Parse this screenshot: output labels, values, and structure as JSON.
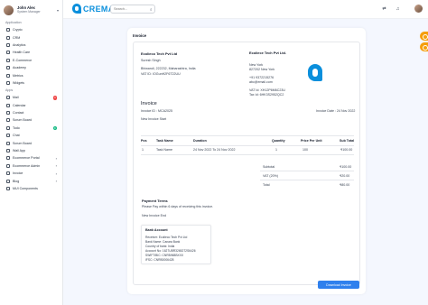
{
  "user": {
    "name": "John Alex",
    "role": "System Manager"
  },
  "sections": {
    "application": "Application",
    "apps": "Apps"
  },
  "app_items": [
    {
      "label": "Crypto"
    },
    {
      "label": "CRM"
    },
    {
      "label": "Analytics"
    },
    {
      "label": "Health Care"
    },
    {
      "label": "E-Commerce"
    },
    {
      "label": "Academy"
    },
    {
      "label": "Metrics"
    },
    {
      "label": "Widgets"
    }
  ],
  "apps_items": [
    {
      "label": "Mail",
      "badge": "4",
      "badge_color": "#ef4444"
    },
    {
      "label": "Calendar"
    },
    {
      "label": "Contact"
    },
    {
      "label": "Scrum Board"
    },
    {
      "label": "Todo",
      "badge": "9",
      "badge_color": "#10b981"
    },
    {
      "label": "Chat"
    },
    {
      "label": "Scrum Board"
    },
    {
      "label": "Wall App"
    },
    {
      "label": "Ecommerce Portal",
      "chevron": "›"
    },
    {
      "label": "Ecommerce Admin",
      "chevron": "›"
    },
    {
      "label": "Invoice",
      "chevron": "›"
    },
    {
      "label": "Blog",
      "chevron": "›"
    },
    {
      "label": "MUI Components"
    }
  ],
  "topbar": {
    "logo": "CREMA",
    "search_placeholder": "Search..."
  },
  "invoice": {
    "card_title": "Invoice",
    "from_company": "Ecolieco Tech Pvt Ltd",
    "from_person": "Suresh Singh",
    "from_address": "Bhiwandi, 222232, Maharashtra, India",
    "from_vat": "VAT ID: IOGunH2F6T22UU",
    "to_company": "Ecoliece Tech Pvt Ltd.",
    "to_city": "New York",
    "to_zip": "827202 New York",
    "to_phone": "+91 9372215276",
    "to_email": "abc@email.com",
    "to_vat": "VAT Id: XH12P6M6C23U",
    "to_tax": "Tax Id: 6HK3S2952QC2",
    "heading": "Invoice",
    "invoice_id": "Invoice ID : MCA2025",
    "invoice_date": "Invoice Date : 24 Nov 2022",
    "subtitle": "New Invoice Start",
    "table_headers": [
      "Pos",
      "Task Name",
      "Duration",
      "Quantity",
      "Price Per Unit",
      "Sub Total"
    ],
    "rows": [
      {
        "pos": "1",
        "task": "Task Name",
        "duration": "24 Nov 2022 To 24 Nov 2022",
        "qty": "1",
        "price": "100",
        "subtotal": "₹100.00"
      }
    ],
    "summary": [
      {
        "label": "Subtotal",
        "value": "₹100.00"
      },
      {
        "label": "VAT (20%)",
        "value": "₹20.00"
      },
      {
        "label": "Total",
        "value": "₹80.00"
      }
    ],
    "payment_terms_title": "Payment Terms",
    "payment_terms_text": "Please Pay within 6 days of receiving this invoice.",
    "end_text": "New Invoice End",
    "bank": {
      "title": "Bank Account",
      "receiver": "Receiver: Ecolieco Tech Pvt Ltd",
      "bank_name": "Bank Name: Canara Bank",
      "country": "Country of bank: India",
      "account": "Account No: 1627UBR3265272S6426",
      "swift": "SWIFT/BIC: CNRBINBBXXX",
      "ifsc": "IFSC: CNRB0006428"
    },
    "download_button": "Download Invoice"
  }
}
